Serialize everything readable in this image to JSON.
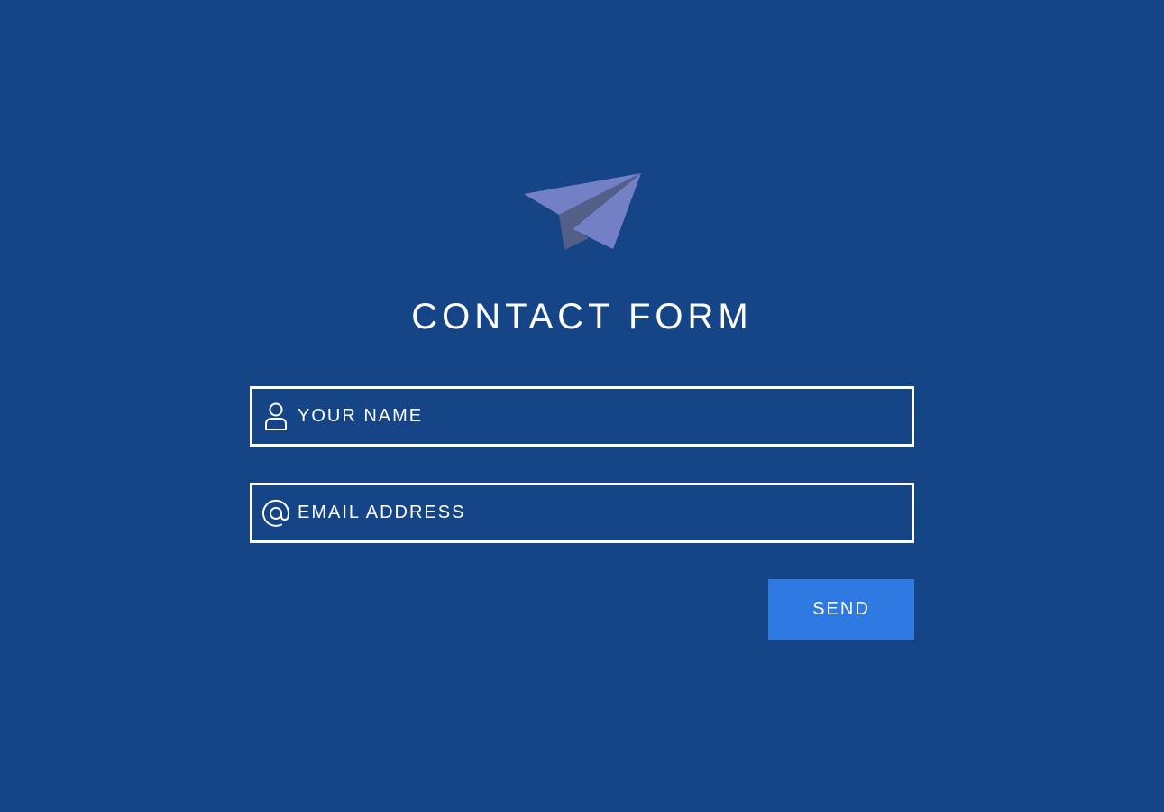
{
  "form": {
    "title": "CONTACT FORM",
    "logo_icon": "paper-plane-icon",
    "name_field": {
      "icon": "user-icon",
      "placeholder": "YOUR NAME",
      "value": ""
    },
    "email_field": {
      "icon": "at-sign-icon",
      "placeholder": "EMAIL ADDRESS",
      "value": ""
    },
    "send_label": "SEND"
  },
  "colors": {
    "background": "#164587",
    "button": "#2f7ae2",
    "plane_light": "#7480c6",
    "plane_dark": "#545f87",
    "text": "#ffffff"
  }
}
